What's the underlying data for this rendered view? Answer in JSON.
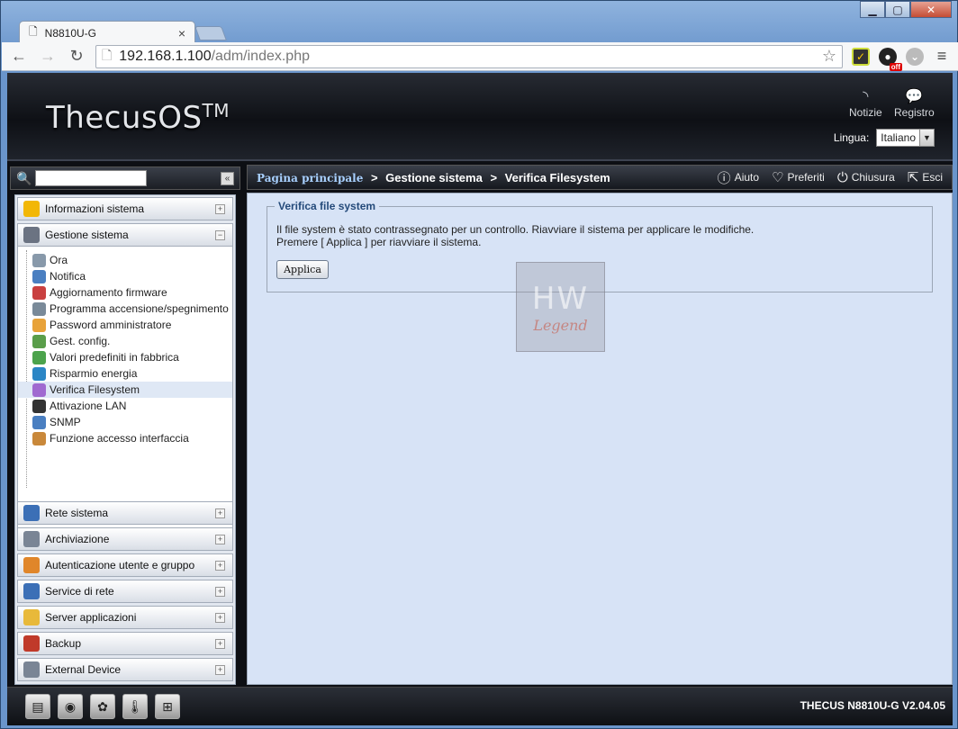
{
  "browser": {
    "tab_title": "N8810U-G",
    "url_host": "192.168.1.100",
    "url_path": "/adm/index.php"
  },
  "header": {
    "logo": "ThecusOS",
    "logo_tm": "TM",
    "news_label": "Notizie",
    "log_label": "Registro",
    "lang_label": "Lingua:",
    "lang_value": "Italiano"
  },
  "sidebar": {
    "top_groups": [
      {
        "label": "Informazioni sistema",
        "icon": "info-icon",
        "color": "#f2b705"
      },
      {
        "label": "Gestione sistema",
        "icon": "tools-icon",
        "color": "#5d6470"
      }
    ],
    "tree_items": [
      {
        "label": "Ora"
      },
      {
        "label": "Notifica"
      },
      {
        "label": "Aggiornamento firmware"
      },
      {
        "label": "Programma accensione/spegnimento"
      },
      {
        "label": "Password amministratore"
      },
      {
        "label": "Gest. config."
      },
      {
        "label": "Valori predefiniti in fabbrica"
      },
      {
        "label": "Risparmio energia"
      },
      {
        "label": "Verifica Filesystem"
      },
      {
        "label": "Attivazione LAN"
      },
      {
        "label": "SNMP"
      },
      {
        "label": "Funzione accesso interfaccia"
      }
    ],
    "bottom_groups": [
      {
        "label": "Rete sistema"
      },
      {
        "label": "Archiviazione"
      },
      {
        "label": "Autenticazione utente e gruppo"
      },
      {
        "label": "Service di rete"
      },
      {
        "label": "Server applicazioni"
      },
      {
        "label": "Backup"
      },
      {
        "label": "External Device"
      }
    ]
  },
  "breadcrumb": {
    "home": "Pagina principale",
    "sep": ">",
    "level1": "Gestione sistema",
    "level2": "Verifica Filesystem"
  },
  "topnav": {
    "help": "Aiuto",
    "favorites": "Preferiti",
    "shutdown": "Chiusura",
    "logout": "Esci"
  },
  "main": {
    "section_title": "Verifica file system",
    "message1": "Il file system è stato contrassegnato per un controllo. Riavviare il sistema per applicare le modifiche.",
    "message2": "Premere [ Applica ] per riavviare il sistema.",
    "apply_label": "Applica"
  },
  "watermark": {
    "top": "HW",
    "bottom": "Legend"
  },
  "footer": {
    "version": "THECUS N8810U-G V2.04.05"
  }
}
